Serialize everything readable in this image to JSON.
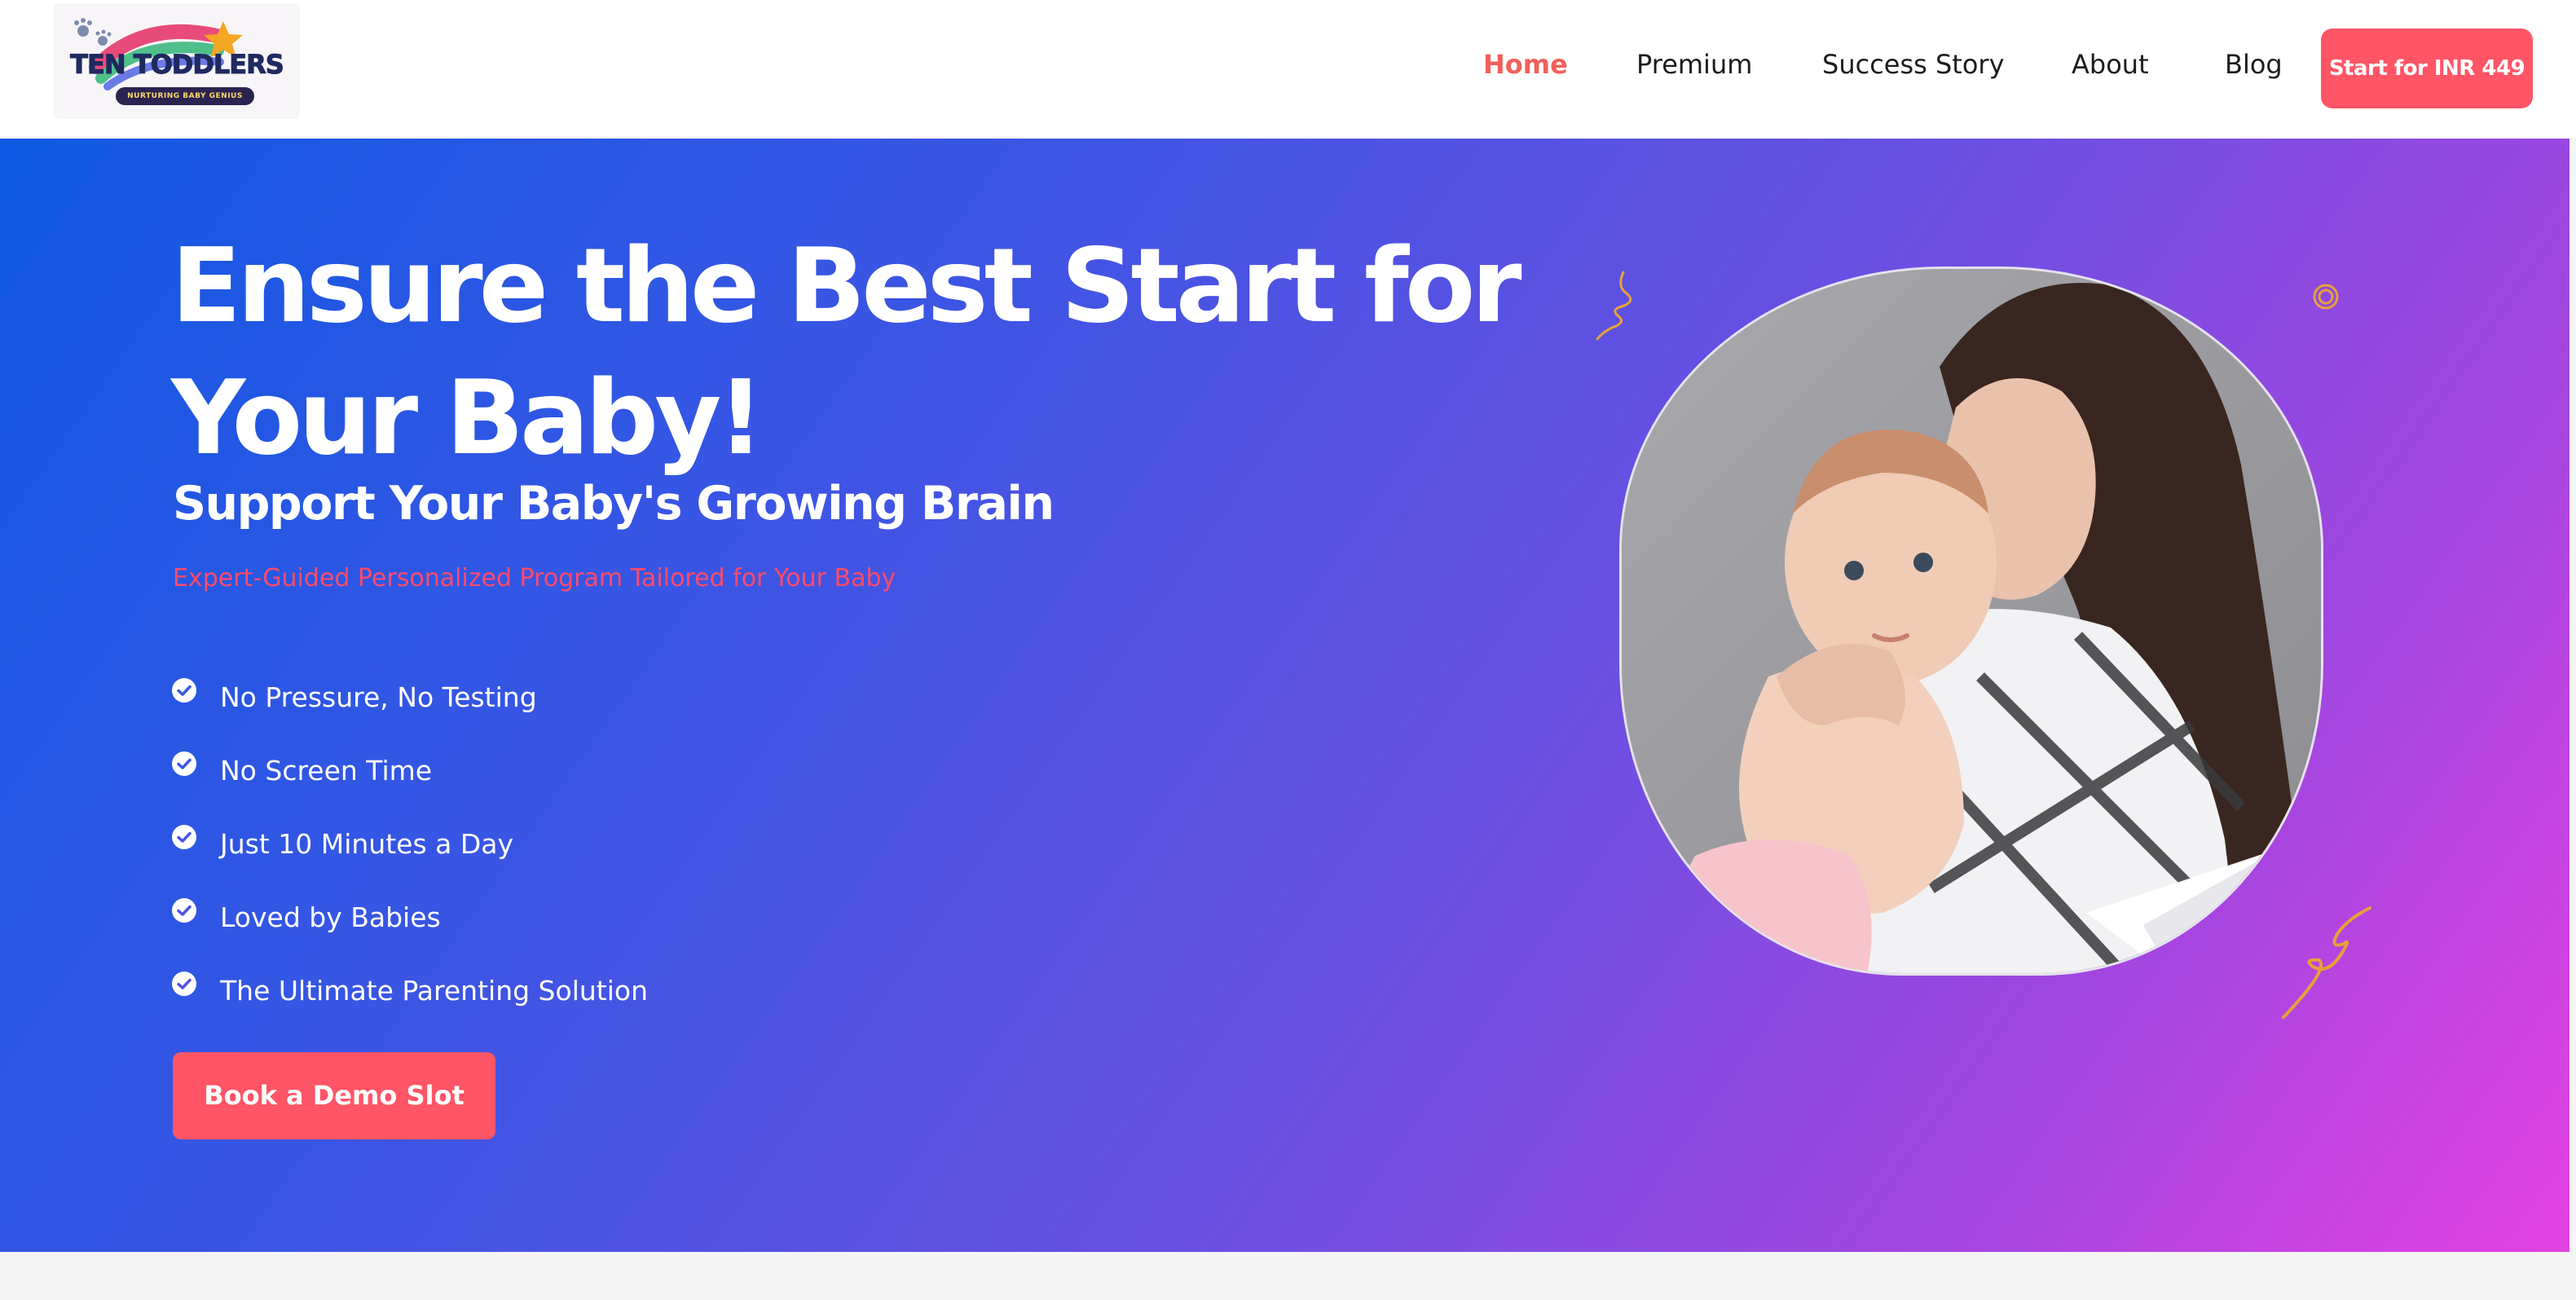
{
  "brand": {
    "name": "TEN TODDLERS",
    "tagline": "NURTURING BABY GENIUS"
  },
  "nav": {
    "items": [
      {
        "label": "Home",
        "active": true
      },
      {
        "label": "Premium",
        "active": false
      },
      {
        "label": "Success Story",
        "active": false
      },
      {
        "label": "About",
        "active": false
      },
      {
        "label": "Blog",
        "active": false
      }
    ],
    "cta": "Start for INR 449"
  },
  "hero": {
    "title": "Ensure the Best Start for Your Baby!",
    "subtitle": "Support Your Baby's Growing Brain",
    "tagline": "Expert-Guided Personalized Program Tailored for Your Baby",
    "features": [
      "No Pressure, No Testing",
      "No Screen Time",
      "Just 10 Minutes a Day",
      "Loved by Babies",
      "The Ultimate Parenting Solution"
    ],
    "button": "Book a Demo Slot"
  },
  "colors": {
    "accent": "#ff5566",
    "active_nav": "#f2605a",
    "gradient_start": "#1059e2",
    "gradient_end": "#e442e2",
    "decor": "#e7a13a"
  },
  "icons": {
    "feature_bullet": "check-circle-icon",
    "photo_overlay": "paper-plane-icon"
  }
}
